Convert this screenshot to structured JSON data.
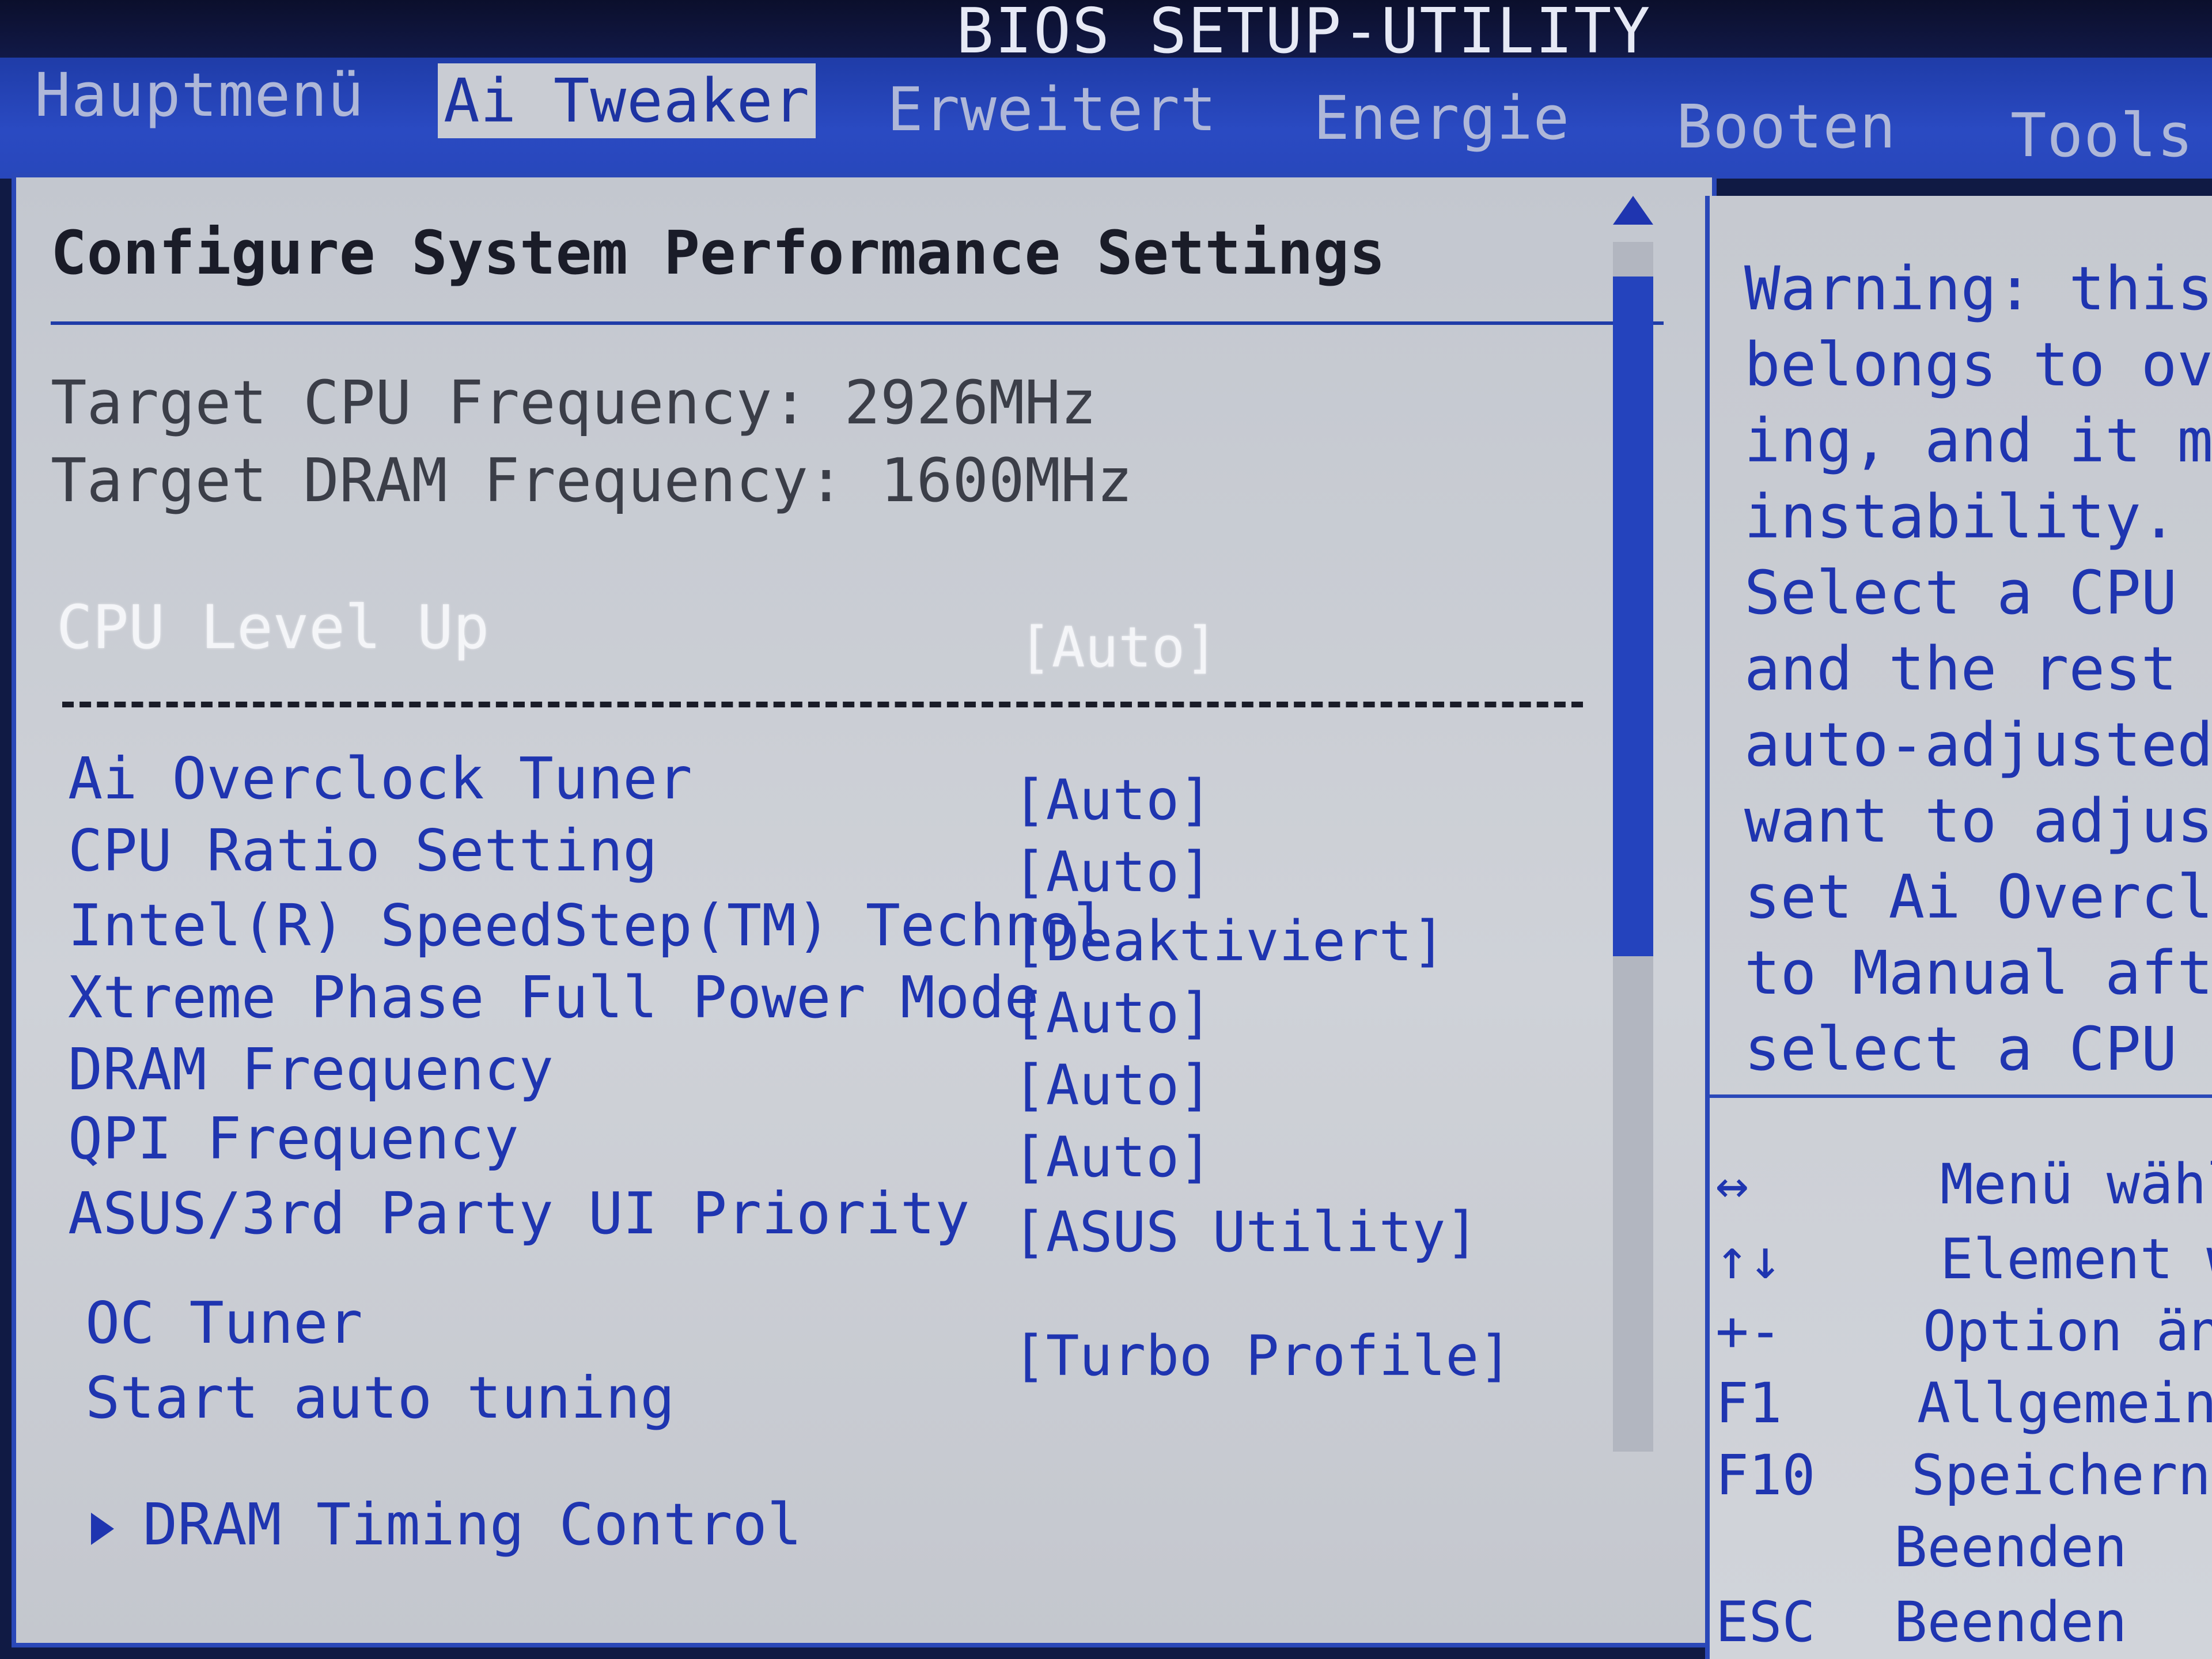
{
  "title": "BIOS SETUP-UTILITY",
  "tabs": [
    {
      "label": "Hauptmenü"
    },
    {
      "label": "Ai Tweaker"
    },
    {
      "label": "Erweitert"
    },
    {
      "label": "Energie"
    },
    {
      "label": "Booten"
    },
    {
      "label": "Tools"
    }
  ],
  "main": {
    "heading": "Configure System Performance Settings",
    "info": [
      "Target CPU Frequency: 2926MHz",
      "Target DRAM Frequency: 1600MHz"
    ],
    "level_up": {
      "label": "CPU Level Up",
      "value": "[Auto]"
    },
    "options": [
      {
        "label": "Ai Overclock Tuner",
        "value": "[Auto]"
      },
      {
        "label": "CPU Ratio Setting",
        "value": "[Auto]"
      },
      {
        "label": "Intel(R) SpeedStep(TM) Technol",
        "value": "[Deaktiviert]"
      },
      {
        "label": "Xtreme Phase Full Power Mode",
        "value": "[Auto]"
      },
      {
        "label": "DRAM Frequency",
        "value": "[Auto]"
      },
      {
        "label": "QPI Frequency",
        "value": "[Auto]"
      },
      {
        "label": "ASUS/3rd Party UI Priority",
        "value": "[ASUS Utility]"
      }
    ],
    "oc_tuner": {
      "label": "OC Tuner",
      "value": "[Turbo Profile]"
    },
    "auto_tuning": {
      "label": "Start auto tuning"
    },
    "submenu": {
      "label": "DRAM Timing Control"
    }
  },
  "help": {
    "lines": [
      "Warning: this",
      "belongs to ove",
      "ing, and it ma",
      "instability.",
      "Select a CPU le",
      "and the rest wi",
      "auto-adjusted.",
      "want to adjust",
      "set Ai Overcloc",
      "to Manual after",
      "select a CPU lev"
    ],
    "keys": [
      {
        "key": "↔",
        "desc": "Menü wählen"
      },
      {
        "key": "↑↓",
        "desc": "Element wäh"
      },
      {
        "key": "+-",
        "desc": "Option ändern"
      },
      {
        "key": "F1",
        "desc": "Allgemeine H"
      },
      {
        "key": "F10",
        "desc": "Speichern und"
      },
      {
        "key": "",
        "desc": "Beenden"
      },
      {
        "key": "ESC",
        "desc": "Beenden"
      }
    ]
  }
}
